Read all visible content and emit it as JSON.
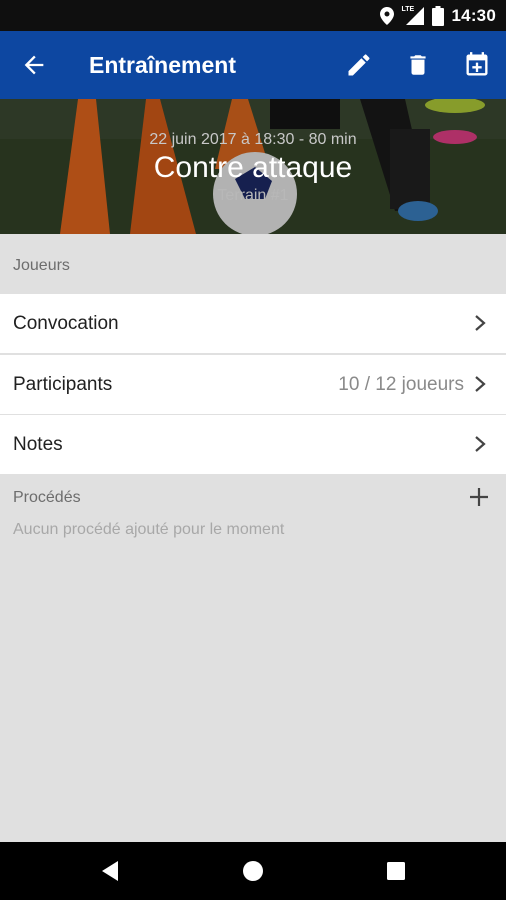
{
  "status_bar": {
    "time": "14:30",
    "network_label": "LTE",
    "icons": [
      "location-icon",
      "lte-signal-icon",
      "battery-icon"
    ]
  },
  "app_bar": {
    "title": "Entraînement",
    "actions": [
      "edit-icon",
      "delete-icon",
      "calendar-add-icon"
    ],
    "color": "#0d47a1"
  },
  "hero": {
    "date": "22 juin 2017 à 18:30 - 80 min",
    "name": "Contre attaque",
    "field": "Terrain #1"
  },
  "players_section": {
    "label": "Joueurs",
    "rows": [
      {
        "label": "Convocation",
        "value": ""
      },
      {
        "label": "Participants",
        "value": "10 / 12 joueurs"
      },
      {
        "label": "Notes",
        "value": ""
      }
    ]
  },
  "procedures_section": {
    "label": "Procédés",
    "empty_text": "Aucun procédé ajouté pour le moment"
  },
  "nav_bar": {
    "buttons": [
      "back-triangle-icon",
      "home-circle-icon",
      "recents-square-icon"
    ]
  }
}
